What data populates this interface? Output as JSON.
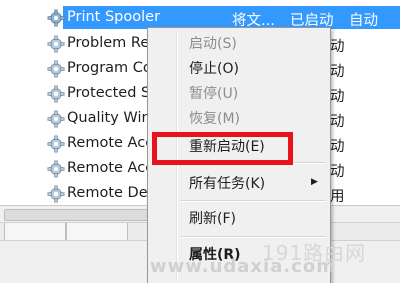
{
  "services": [
    {
      "name": "Print Spooler",
      "description": "将文...",
      "status": "已启动",
      "startup": "自动",
      "selected": true
    },
    {
      "name": "Problem Re",
      "status": "动",
      "selected": false
    },
    {
      "name": "Program Co",
      "status": "动",
      "selected": false
    },
    {
      "name": "Protected S",
      "status": "动",
      "selected": false
    },
    {
      "name": "Quality Win",
      "status": "动",
      "selected": false
    },
    {
      "name": "Remote Acc",
      "status": "动",
      "selected": false
    },
    {
      "name": "Remote Acc",
      "status": "动",
      "selected": false
    },
    {
      "name": "Remote Des",
      "status": "用",
      "selected": false
    }
  ],
  "context_menu": {
    "start": "启动(S)",
    "stop": "停止(O)",
    "pause": "暂停(U)",
    "resume": "恢复(M)",
    "restart": "重新启动(E)",
    "all_tasks": "所有任务(K)",
    "refresh": "刷新(F)",
    "properties": "属性(R)"
  },
  "watermark": {
    "site_name": "191路由网",
    "site_url": "www.udaxia.com"
  },
  "colors": {
    "selection": "#3399ff",
    "highlight_box": "#e8121c"
  }
}
